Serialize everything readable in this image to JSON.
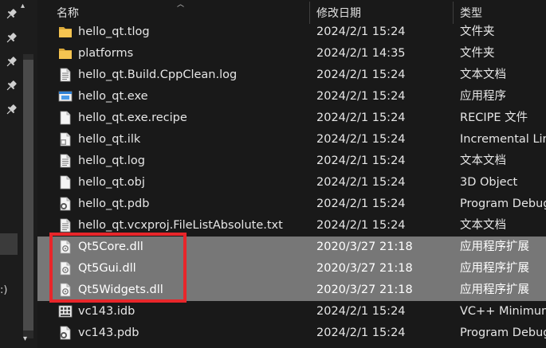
{
  "columns": {
    "name": "名称",
    "date": "修改日期",
    "type": "类型"
  },
  "nav_fragment": ":)",
  "files": [
    {
      "name": "hello_qt.tlog",
      "date": "2024/2/1 15:24",
      "type": "文件夹",
      "icon": "folder-icon",
      "selected": false
    },
    {
      "name": "platforms",
      "date": "2024/2/1 14:35",
      "type": "文件夹",
      "icon": "folder-icon",
      "selected": false
    },
    {
      "name": "hello_qt.Build.CppClean.log",
      "date": "2024/2/1 15:24",
      "type": "文本文档",
      "icon": "text-file-icon",
      "selected": false
    },
    {
      "name": "hello_qt.exe",
      "date": "2024/2/1 15:24",
      "type": "应用程序",
      "icon": "exe-icon",
      "selected": false
    },
    {
      "name": "hello_qt.exe.recipe",
      "date": "2024/2/1 15:24",
      "type": "RECIPE 文件",
      "icon": "file-icon",
      "selected": false
    },
    {
      "name": "hello_qt.ilk",
      "date": "2024/2/1 15:24",
      "type": "Incremental Lin",
      "icon": "ilk-file-icon",
      "selected": false
    },
    {
      "name": "hello_qt.log",
      "date": "2024/2/1 15:24",
      "type": "文本文档",
      "icon": "text-file-icon",
      "selected": false
    },
    {
      "name": "hello_qt.obj",
      "date": "2024/2/1 15:24",
      "type": "3D Object",
      "icon": "file-icon",
      "selected": false
    },
    {
      "name": "hello_qt.pdb",
      "date": "2024/2/1 15:24",
      "type": "Program Debug",
      "icon": "pdb-file-icon",
      "selected": false
    },
    {
      "name": "hello_qt.vcxproj.FileListAbsolute.txt",
      "date": "2024/2/1 15:24",
      "type": "文本文档",
      "icon": "text-file-icon",
      "selected": false
    },
    {
      "name": "Qt5Core.dll",
      "date": "2020/3/27 21:18",
      "type": "应用程序扩展",
      "icon": "dll-file-icon",
      "selected": true
    },
    {
      "name": "Qt5Gui.dll",
      "date": "2020/3/27 21:18",
      "type": "应用程序扩展",
      "icon": "dll-file-icon",
      "selected": true
    },
    {
      "name": "Qt5Widgets.dll",
      "date": "2020/3/27 21:18",
      "type": "应用程序扩展",
      "icon": "dll-file-icon",
      "selected": true
    },
    {
      "name": "vc143.idb",
      "date": "2024/2/1 15:24",
      "type": "VC++ Minimum",
      "icon": "idb-file-icon",
      "selected": false
    },
    {
      "name": "vc143.pdb",
      "date": "2024/2/1 15:24",
      "type": "Program Debug",
      "icon": "pdb-file-icon",
      "selected": false
    }
  ],
  "highlight_color": "#e8262a",
  "selection_color": "#777777"
}
